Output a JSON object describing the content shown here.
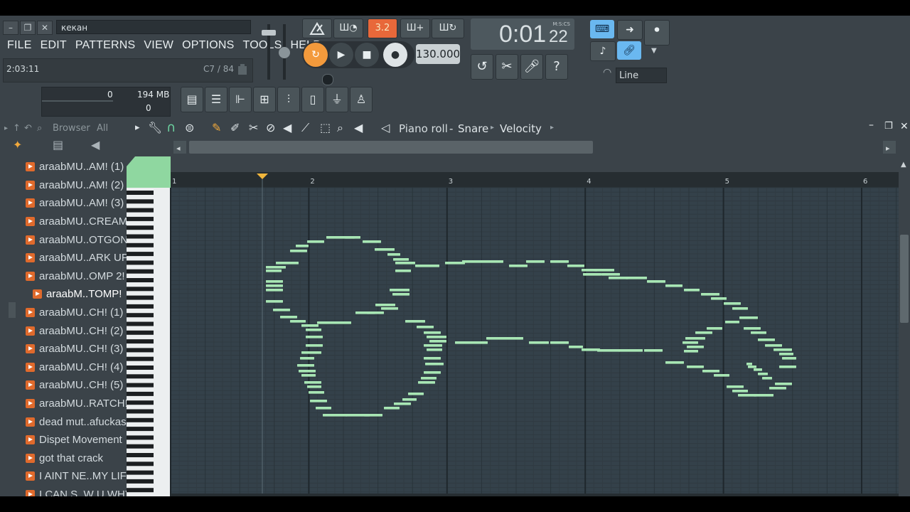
{
  "window": {
    "title_value": "кекан",
    "minimize": "–",
    "restore": "❐",
    "close": "✕"
  },
  "menu": [
    "FILE",
    "EDIT",
    "PATTERNS",
    "VIEW",
    "OPTIONS",
    "TOOLS",
    "HELP"
  ],
  "hint": {
    "left": "2:03:11",
    "right": "C7 / 84"
  },
  "transport": {
    "pattern_song": "3.2",
    "tempo": "130.000",
    "time": "0:01",
    "time_sub": "22",
    "time_unit": "M:S:CS"
  },
  "snap": {
    "mode": "Line"
  },
  "cpu": {
    "value": "0",
    "memory": "194 MB",
    "polyphony": "0"
  },
  "browser": {
    "label": "Browser",
    "filter": "All",
    "items": [
      "araabMU..AM! (1)",
      "araabMU..AM! (2)",
      "araabMU..AM! (3)",
      "araabMU..CREAM!",
      "araabMU..OTGON",
      "araabMU..ARK UP",
      "araabMU..OMP 2!",
      "araabM..TOMP!",
      "araabMU..CH! (1)",
      "araabMU..CH! (2)",
      "araabMU..CH! (3)",
      "araabMU..CH! (4)",
      "araabMU..CH! (5)",
      "araabMU..RATCH!",
      "dead mut..afuckas",
      "Dispet Movement",
      "got that crack",
      "I AINT NE..MY LIFE",
      "I CAN S..W U WHY"
    ],
    "selected_index": 7
  },
  "piano_roll": {
    "title": "Piano roll",
    "channel": "Snare",
    "target": "Velocity",
    "bar_numbers": [
      "1",
      "2",
      "3",
      "4",
      "5",
      "6"
    ]
  },
  "colors": {
    "note": "#a8e6b4",
    "grid_bg": "#34414a",
    "accent_orange": "#e8683a",
    "accent_blue": "#6ab8f0"
  }
}
